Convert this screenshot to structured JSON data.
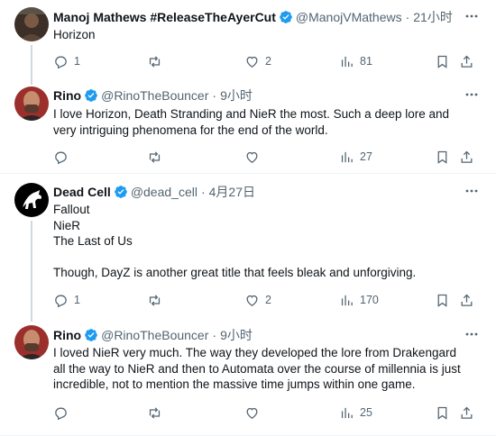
{
  "tweets": [
    {
      "name": "Manoj Mathews #ReleaseTheAyerCut",
      "handle": "@ManojVMathews",
      "time": "21小时",
      "body": "Horizon",
      "replies": "1",
      "retweets": "",
      "likes": "2",
      "views": "81"
    },
    {
      "name": "Rino",
      "handle": "@RinoTheBouncer",
      "time": "9小时",
      "body": "I love Horizon, Death Stranding and NieR the most. Such a deep lore and very intriguing phenomena for the end of the world.",
      "replies": "",
      "retweets": "",
      "likes": "",
      "views": "27"
    },
    {
      "name": "Dead Cell",
      "handle": "@dead_cell",
      "time": "4月27日",
      "body": "Fallout\nNieR\nThe Last of Us\n\nThough, DayZ is another great title that feels bleak and unforgiving.",
      "replies": "1",
      "retweets": "",
      "likes": "2",
      "views": "170"
    },
    {
      "name": "Rino",
      "handle": "@RinoTheBouncer",
      "time": "9小时",
      "body": "I loved NieR very much. The way they developed the lore from Drakengard all the way to NieR and then to Automata over the course of millennia is just incredible, not to mention the massive time jumps within one game.",
      "replies": "",
      "retweets": "",
      "likes": "",
      "views": "25"
    }
  ],
  "separator": "·",
  "colors": {
    "verified": "#1d9bf0",
    "muted": "#536471",
    "text": "#0f1419",
    "thread_line": "#cfd9de"
  }
}
